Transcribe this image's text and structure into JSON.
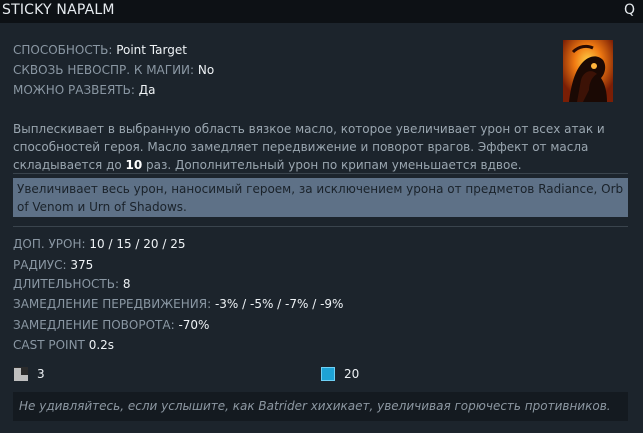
{
  "ability": {
    "name": "STICKY NAPALM",
    "hotkey": "Q",
    "icon": "sticky-napalm-ability-icon"
  },
  "properties": [
    {
      "label": "СПОСОБНОСТЬ:",
      "value": "Point Target"
    },
    {
      "label": "СКВОЗЬ НЕВОСПР. К МАГИИ:",
      "value": "No"
    },
    {
      "label": "МОЖНО РАЗВЕЯТЬ:",
      "value": "Да"
    }
  ],
  "description": {
    "before": "Выплескивает в выбранную область вязкое масло, которое увеличивает урон от всех атак и способностей героя. Масло замедляет передвижение и поворот врагов. Эффект от масла складывается до ",
    "stack_count": "10",
    "after": " раз. Дополнительный урон по крипам уменьшается вдвое."
  },
  "scepter_note": "Увеличивает весь урон, наносимый героем, за исключением урона от предметов Radiance, Orb of Venom и Urn of Shadows.",
  "stats": [
    {
      "label": "ДОП. УРОН:",
      "value": "10 / 15 / 20 / 25"
    },
    {
      "label": "РАДИУС:",
      "value": "375"
    },
    {
      "label": "ДЛИТЕЛЬНОСТЬ:",
      "value": "8"
    },
    {
      "label": "ЗАМЕДЛЕНИЕ ПЕРЕДВИЖЕНИЯ:",
      "value": "-3% / -5% / -7% / -9%"
    },
    {
      "label": "ЗАМЕДЛЕНИЕ ПОВОРОТА:",
      "value": "-70%"
    },
    {
      "label": "CAST POINT",
      "value": "0.2s"
    }
  ],
  "cooldown": {
    "value": "3",
    "icon": "cooldown-icon"
  },
  "manacost": {
    "value": "20",
    "icon": "mana-icon"
  },
  "lore": "Не удивляйтесь, если услышите, как Batrider хихикает, увеличивая горючесть противников.",
  "colors": {
    "background": "#1c242c",
    "title_bar": "#0d1115",
    "scepter_box": "#5e7187",
    "mana": "#1ea3d6",
    "label": "#8a97a3",
    "value": "#eef2f5"
  }
}
